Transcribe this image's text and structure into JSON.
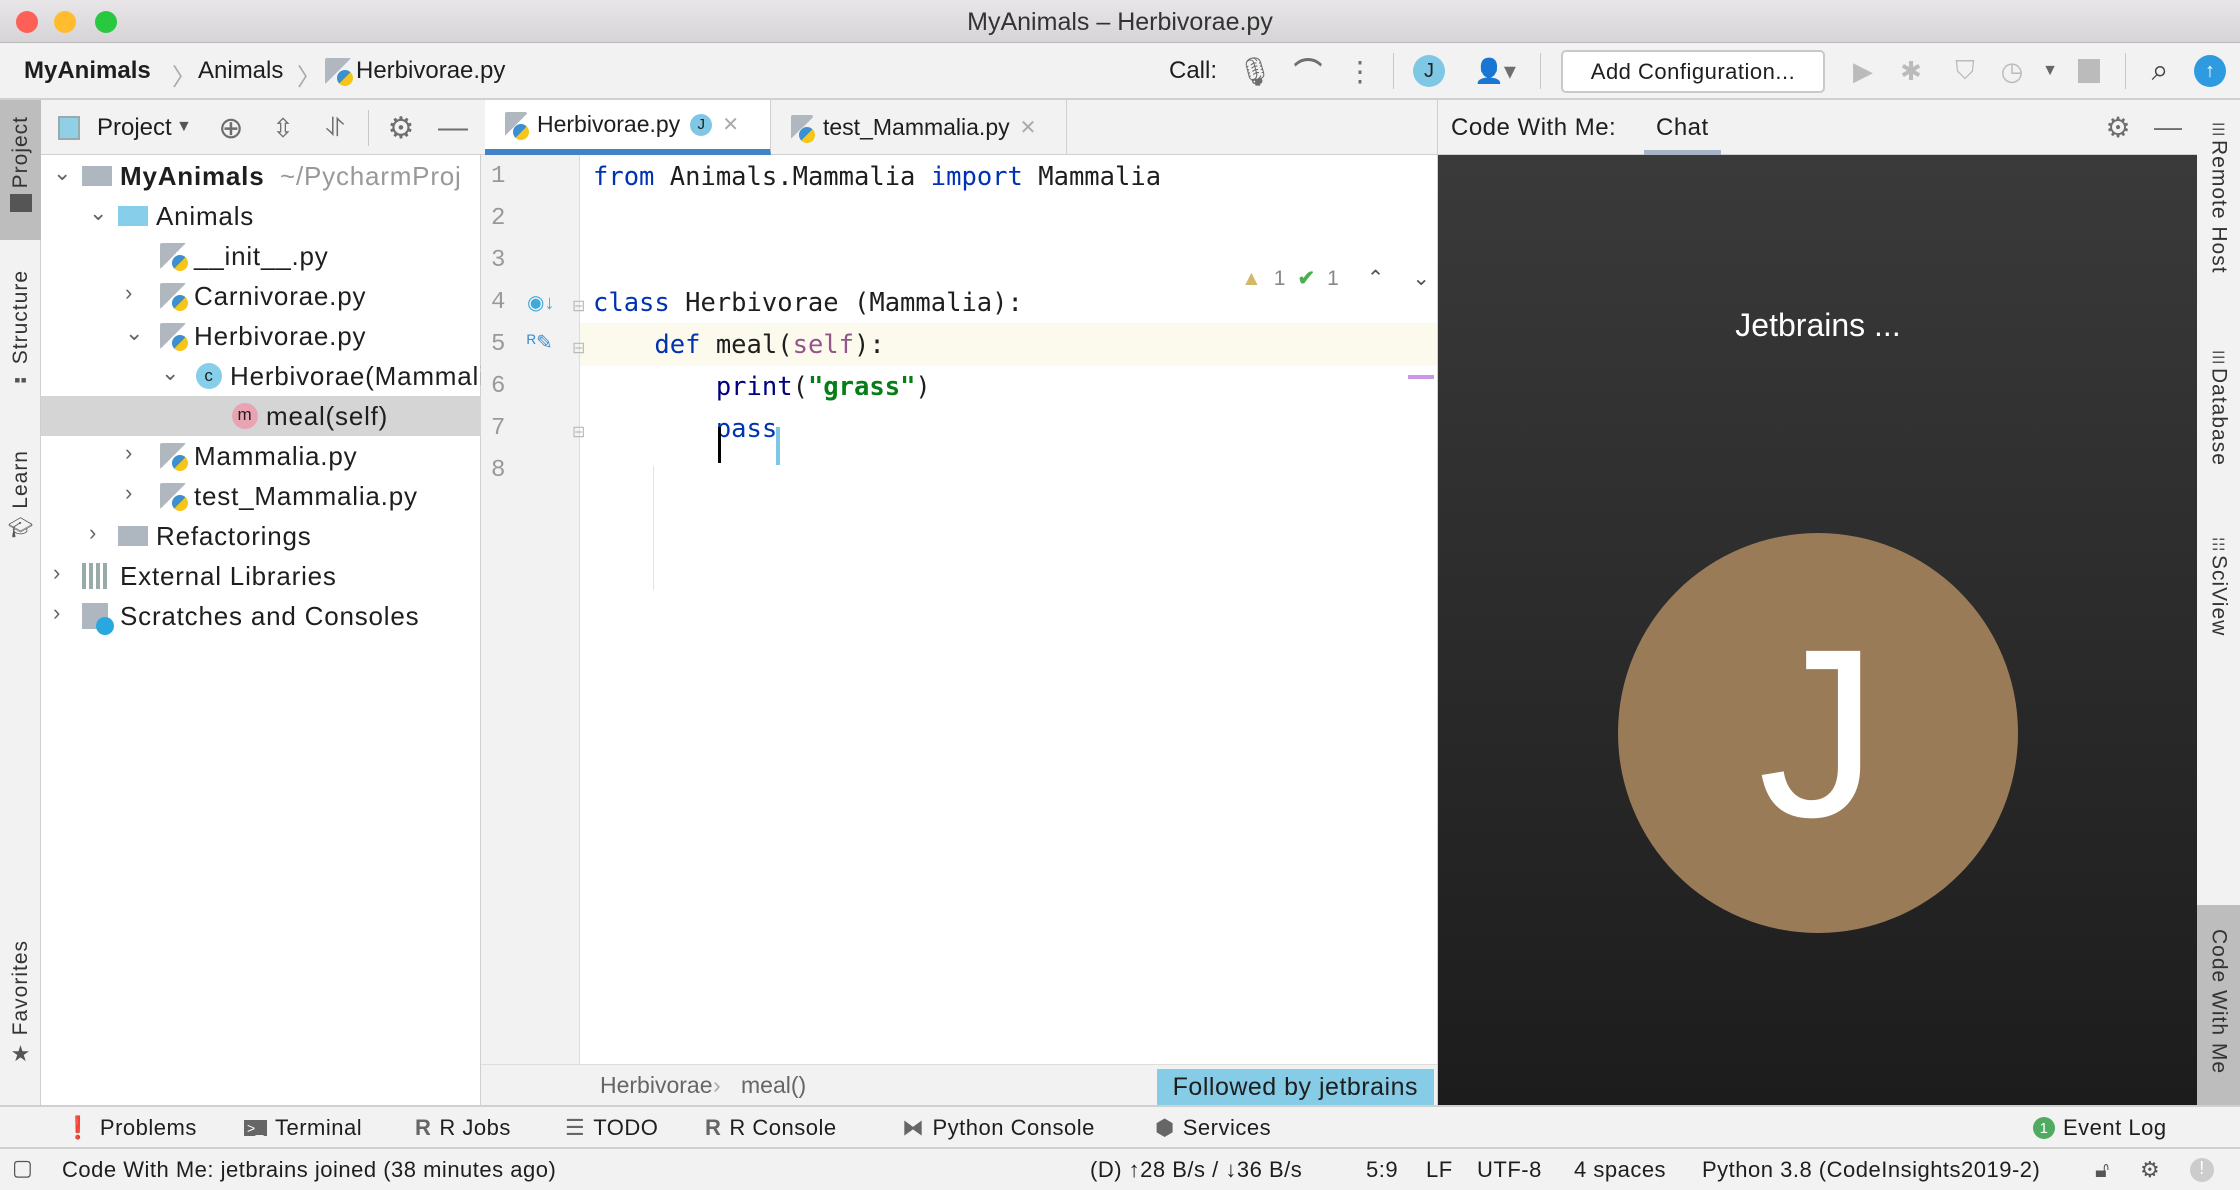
{
  "window": {
    "title": "MyAnimals – Herbivorae.py",
    "traffic_colors": [
      "#fe5f57",
      "#febc2e",
      "#28c840"
    ]
  },
  "nav": {
    "breadcrumb": [
      "MyAnimals",
      "Animals",
      "Herbivorae.py"
    ],
    "call_label": "Call:",
    "user_initial": "J",
    "add_configuration": "Add Configuration..."
  },
  "left_strip": {
    "project": "Project",
    "structure": "Structure",
    "learn": "Learn",
    "favorites": "Favorites"
  },
  "project": {
    "header": "Project",
    "tree": [
      {
        "label": "MyAnimals",
        "suffix": "~/PycharmProj",
        "depth": 0,
        "icon": "folder-icon",
        "chevron": "down",
        "bold": true
      },
      {
        "label": "Animals",
        "depth": 1,
        "icon": "package-folder-icon",
        "chevron": "down"
      },
      {
        "label": "__init__.py",
        "depth": 2,
        "icon": "python-file-icon",
        "chevron": ""
      },
      {
        "label": "Carnivorae.py",
        "depth": 2,
        "icon": "python-file-icon",
        "chevron": "right"
      },
      {
        "label": "Herbivorae.py",
        "depth": 2,
        "icon": "python-file-icon",
        "chevron": "down"
      },
      {
        "label": "Herbivorae(Mammalia)",
        "depth": 3,
        "icon": "class-icon",
        "chevron": "down",
        "badge": "c"
      },
      {
        "label": "meal(self)",
        "depth": 4,
        "icon": "method-icon",
        "chevron": "",
        "badge": "m",
        "selected": true
      },
      {
        "label": "Mammalia.py",
        "depth": 2,
        "icon": "python-file-icon",
        "chevron": "right"
      },
      {
        "label": "test_Mammalia.py",
        "depth": 2,
        "icon": "python-file-icon",
        "chevron": "right"
      },
      {
        "label": "Refactorings",
        "depth": 1,
        "icon": "folder-icon",
        "chevron": "right"
      },
      {
        "label": "External Libraries",
        "depth": 0,
        "icon": "libraries-icon",
        "chevron": "right"
      },
      {
        "label": "Scratches and Consoles",
        "depth": 0,
        "icon": "scratches-icon",
        "chevron": "right"
      }
    ]
  },
  "editor": {
    "tabs": [
      {
        "label": "Herbivorae.py",
        "badge": "J",
        "active": true
      },
      {
        "label": "test_Mammalia.py",
        "active": false
      }
    ],
    "line_numbers": [
      "1",
      "2",
      "3",
      "4",
      "5",
      "6",
      "7",
      "8"
    ],
    "lines": [
      [
        {
          "t": "from",
          "c": "kw"
        },
        {
          "t": " Animals.Mammalia ",
          "c": "idn"
        },
        {
          "t": "import",
          "c": "kw"
        },
        {
          "t": " Mammalia",
          "c": "idn"
        }
      ],
      [],
      [],
      [
        {
          "t": "class",
          "c": "kw"
        },
        {
          "t": " Herbivorae (Mammalia):",
          "c": "idn"
        }
      ],
      [
        {
          "t": "    def",
          "c": "kw"
        },
        {
          "t": " meal",
          "c": "fn"
        },
        {
          "t": "(",
          "c": "idn"
        },
        {
          "t": "self",
          "c": "slf"
        },
        {
          "t": "):",
          "c": "idn"
        }
      ],
      [
        {
          "t": "        print",
          "c": "bi"
        },
        {
          "t": "(",
          "c": "idn"
        },
        {
          "t": "\"grass\"",
          "c": "str"
        },
        {
          "t": ")",
          "c": "idn"
        }
      ],
      [
        {
          "t": "        pass",
          "c": "kw"
        }
      ],
      []
    ],
    "inspections": {
      "warnings": "1",
      "ok": "1"
    },
    "breadcrumb": [
      "Herbivorae",
      "meal()"
    ],
    "followed": "Followed by jetbrains"
  },
  "cwm": {
    "label": "Code With Me:",
    "tab": "Chat",
    "participant": "Jetbrains ...",
    "avatar_initial": "J",
    "avatar_color": "#9a7b58",
    "hangup_color": "#c0201c"
  },
  "right_strip": {
    "remote_host": "Remote Host",
    "database": "Database",
    "sciview": "SciView",
    "code_with_me": "Code With Me"
  },
  "bottom_tools": [
    {
      "label": "Problems",
      "icon": "problems-icon"
    },
    {
      "label": "Terminal",
      "icon": "terminal-icon"
    },
    {
      "label": "R Jobs",
      "icon": "r-icon"
    },
    {
      "label": "TODO",
      "icon": "todo-icon"
    },
    {
      "label": "R Console",
      "icon": "r-icon"
    },
    {
      "label": "Python Console",
      "icon": "python-icon"
    },
    {
      "label": "Services",
      "icon": "services-icon"
    }
  ],
  "event_log": {
    "label": "Event Log",
    "count": "1"
  },
  "status": {
    "message": "Code With Me: jetbrains joined (38 minutes ago)",
    "traffic": "(D) ↑28 B/s / ↓36 B/s",
    "position": "5:9",
    "line_sep": "LF",
    "encoding": "UTF-8",
    "indent": "4 spaces",
    "interpreter": "Python 3.8 (CodeInsights2019-2)"
  }
}
